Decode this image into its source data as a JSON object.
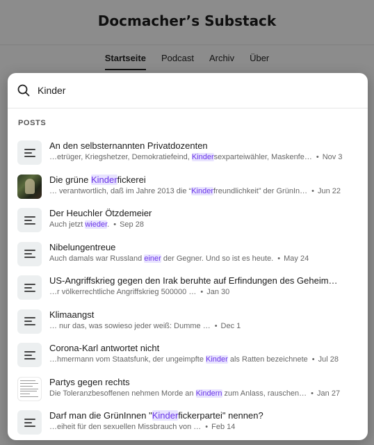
{
  "background": {
    "title": "Docmacher’s Substack",
    "nav": [
      "Startseite",
      "Podcast",
      "Archiv",
      "Über"
    ],
    "active_nav": "Startseite"
  },
  "search": {
    "query": "Kinder",
    "placeholder": ""
  },
  "section_label": "POSTS",
  "posts": [
    {
      "thumb": "lines-icon",
      "title": [
        [
          "An den selbsternannten Privatdozenten",
          false
        ]
      ],
      "snippet": [
        [
          "…etrüger, Kriegshetzer, Demokratiefeind, ",
          false
        ],
        [
          "Kinder",
          true
        ],
        [
          "sexparteiwähler, Maskenfe…",
          false
        ]
      ],
      "date": "Nov 3"
    },
    {
      "thumb": "photo",
      "title": [
        [
          "Die grüne ",
          false
        ],
        [
          "Kinder",
          true
        ],
        [
          "fickerei",
          false
        ]
      ],
      "snippet": [
        [
          "… verantwortlich, daß im Jahre 2013 die “",
          false
        ],
        [
          "Kinder",
          true
        ],
        [
          "freundlichkeit” der GrünIn…",
          false
        ]
      ],
      "date": "Jun 22"
    },
    {
      "thumb": "lines-icon",
      "title": [
        [
          "Der Heuchler Ötzdemeier",
          false
        ]
      ],
      "snippet": [
        [
          "Auch jetzt ",
          false
        ],
        [
          "wieder",
          true
        ],
        [
          ".",
          false
        ]
      ],
      "date": "Sep 28"
    },
    {
      "thumb": "lines-icon",
      "title": [
        [
          "Nibelungentreue",
          false
        ]
      ],
      "snippet": [
        [
          "Auch damals war Russland ",
          false
        ],
        [
          "einer",
          true
        ],
        [
          " der Gegner.  Und so ist es heute.",
          false
        ]
      ],
      "date": "May 24"
    },
    {
      "thumb": "lines-icon",
      "title": [
        [
          "US-Angriffskrieg gegen den Irak beruhte auf Erfindungen des Geheim…",
          false
        ]
      ],
      "snippet": [
        [
          "…r völkerrechtliche Angriffskrieg 500000 …",
          false
        ]
      ],
      "date": "Jan 30"
    },
    {
      "thumb": "lines-icon",
      "title": [
        [
          "Klimaangst",
          false
        ]
      ],
      "snippet": [
        [
          "… nur das, was sowieso jeder weiß: Dumme …",
          false
        ]
      ],
      "date": "Dec 1"
    },
    {
      "thumb": "lines-icon",
      "title": [
        [
          "Corona-Karl antwortet nicht",
          false
        ]
      ],
      "snippet": [
        [
          "…hmermann vom Staatsfunk, der ungeimpfte ",
          false
        ],
        [
          "Kinder",
          true
        ],
        [
          " als Ratten bezeichnete",
          false
        ]
      ],
      "date": "Jul 28"
    },
    {
      "thumb": "document",
      "title": [
        [
          "Partys gegen rechts",
          false
        ]
      ],
      "snippet": [
        [
          "Die Toleranzbesoffenen nehmen Morde an ",
          false
        ],
        [
          "Kindern",
          true
        ],
        [
          " zum Anlass, rauschen…",
          false
        ]
      ],
      "date": "Jan 27"
    },
    {
      "thumb": "lines-icon",
      "title": [
        [
          "Darf man die GrünInnen \"",
          false
        ],
        [
          "Kinder",
          true
        ],
        [
          "fickerpartei\" nennen?",
          false
        ]
      ],
      "snippet": [
        [
          "…eiheit für den sexuellen Missbrauch von …",
          false
        ]
      ],
      "date": "Feb 14"
    }
  ]
}
